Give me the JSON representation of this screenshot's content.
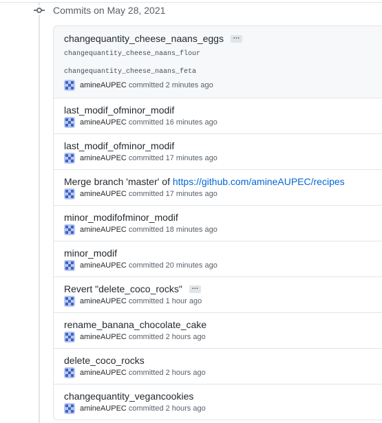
{
  "group": {
    "title": "Commits on May 28, 2021"
  },
  "commits": [
    {
      "title": "changequantity_cheese_naans_eggs",
      "ellipsis": "…",
      "body": [
        "changequantity_cheese_naans_flour",
        "changequantity_cheese_naans_feta"
      ],
      "author": "amineAUPEC",
      "verb": "committed",
      "time": "2 minutes ago"
    },
    {
      "title": "last_modif_ofminor_modif",
      "author": "amineAUPEC",
      "verb": "committed",
      "time": "16 minutes ago"
    },
    {
      "title": "last_modif_ofminor_modif",
      "author": "amineAUPEC",
      "verb": "committed",
      "time": "17 minutes ago"
    },
    {
      "title_prefix": "Merge branch 'master' of ",
      "title_link": "https://github.com/amineAUPEC/recipes",
      "author": "amineAUPEC",
      "verb": "committed",
      "time": "17 minutes ago"
    },
    {
      "title": "minor_modifofminor_modif",
      "author": "amineAUPEC",
      "verb": "committed",
      "time": "18 minutes ago"
    },
    {
      "title": "minor_modif",
      "author": "amineAUPEC",
      "verb": "committed",
      "time": "20 minutes ago"
    },
    {
      "title": "Revert \"delete_coco_rocks\"",
      "ellipsis": "…",
      "author": "amineAUPEC",
      "verb": "committed",
      "time": "1 hour ago"
    },
    {
      "title": "rename_banana_chocolate_cake",
      "author": "amineAUPEC",
      "verb": "committed",
      "time": "2 hours ago"
    },
    {
      "title": "delete_coco_rocks",
      "author": "amineAUPEC",
      "verb": "committed",
      "time": "2 hours ago"
    },
    {
      "title": "changequantity_vegancookies",
      "author": "amineAUPEC",
      "verb": "committed",
      "time": "2 hours ago"
    }
  ]
}
